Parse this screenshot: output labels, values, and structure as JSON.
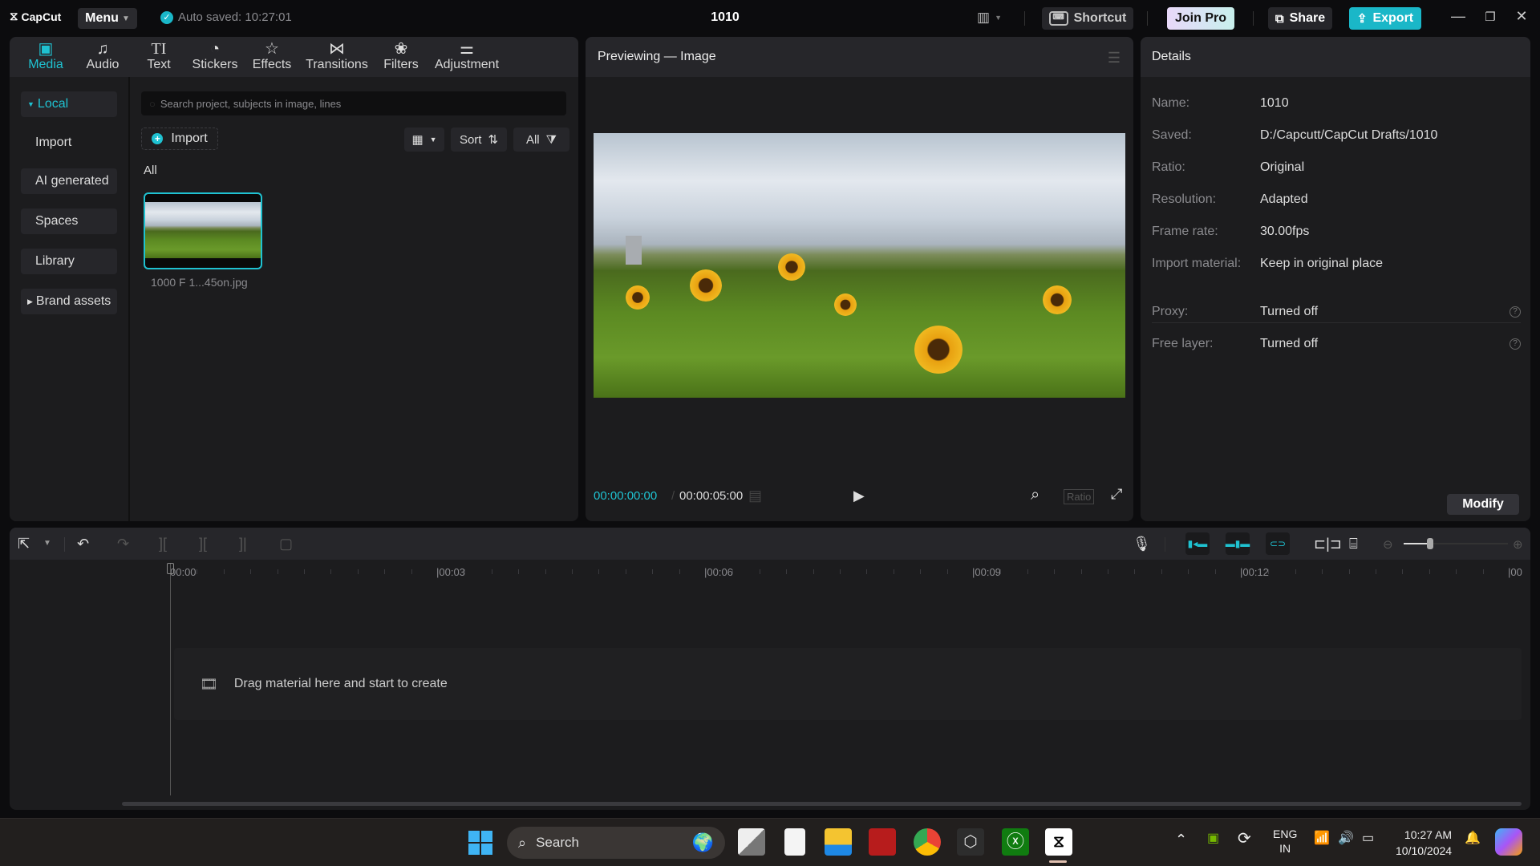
{
  "titlebar": {
    "app_name": "CapCut",
    "menu_label": "Menu",
    "autosave": "Auto saved: 10:27:01",
    "project_title": "1010",
    "shortcut_label": "Shortcut",
    "join_pro_label": "Join Pro",
    "share_label": "Share",
    "export_label": "Export"
  },
  "media_tabs": [
    {
      "label": "Media",
      "icon": "media-icon",
      "active": true
    },
    {
      "label": "Audio",
      "icon": "audio-icon"
    },
    {
      "label": "Text",
      "icon": "text-icon"
    },
    {
      "label": "Stickers",
      "icon": "stickers-icon"
    },
    {
      "label": "Effects",
      "icon": "effects-icon"
    },
    {
      "label": "Transitions",
      "icon": "transitions-icon"
    },
    {
      "label": "Filters",
      "icon": "filters-icon"
    },
    {
      "label": "Adjustment",
      "icon": "adjustment-icon"
    }
  ],
  "sidebar": {
    "items": [
      {
        "label": "Local",
        "expanded": true,
        "active": true
      },
      {
        "label": "Import"
      },
      {
        "label": "AI generated"
      },
      {
        "label": "Spaces"
      },
      {
        "label": "Library"
      },
      {
        "label": "Brand assets",
        "expanded": false
      }
    ]
  },
  "media": {
    "search_placeholder": "Search project, subjects in image, lines",
    "import_label": "Import",
    "sort_label": "Sort",
    "filter_label": "All",
    "section_label": "All",
    "items": [
      {
        "name": "1000 F 1...45on.jpg"
      }
    ]
  },
  "preview": {
    "title": "Previewing — Image",
    "current_time": "00:00:00:00",
    "total_time": "00:00:05:00",
    "ratio_label": "Ratio"
  },
  "details": {
    "title": "Details",
    "rows": [
      {
        "key": "Name:",
        "value": "1010"
      },
      {
        "key": "Saved:",
        "value": "D:/Capcutt/CapCut Drafts/1010"
      },
      {
        "key": "Ratio:",
        "value": "Original"
      },
      {
        "key": "Resolution:",
        "value": "Adapted"
      },
      {
        "key": "Frame rate:",
        "value": "30.00fps"
      },
      {
        "key": "Import material:",
        "value": "Keep in original place"
      },
      {
        "key": "Proxy:",
        "value": "Turned off",
        "help": true
      },
      {
        "key": "Free layer:",
        "value": "Turned off",
        "help": true
      }
    ],
    "modify_label": "Modify"
  },
  "timeline": {
    "ruler_labels": [
      "00:00",
      "|00:03",
      "|00:06",
      "|00:09",
      "|00:12",
      "|00"
    ],
    "drop_hint": "Drag material here and start to create",
    "zoom_level": 0.25
  },
  "taskbar": {
    "search_label": "Search",
    "lang_top": "ENG",
    "lang_bottom": "IN",
    "time": "10:27 AM",
    "date": "10/10/2024"
  },
  "colors": {
    "accent": "#1fc2d1",
    "background": "#0c0c0e",
    "panel": "#1c1c1e"
  }
}
